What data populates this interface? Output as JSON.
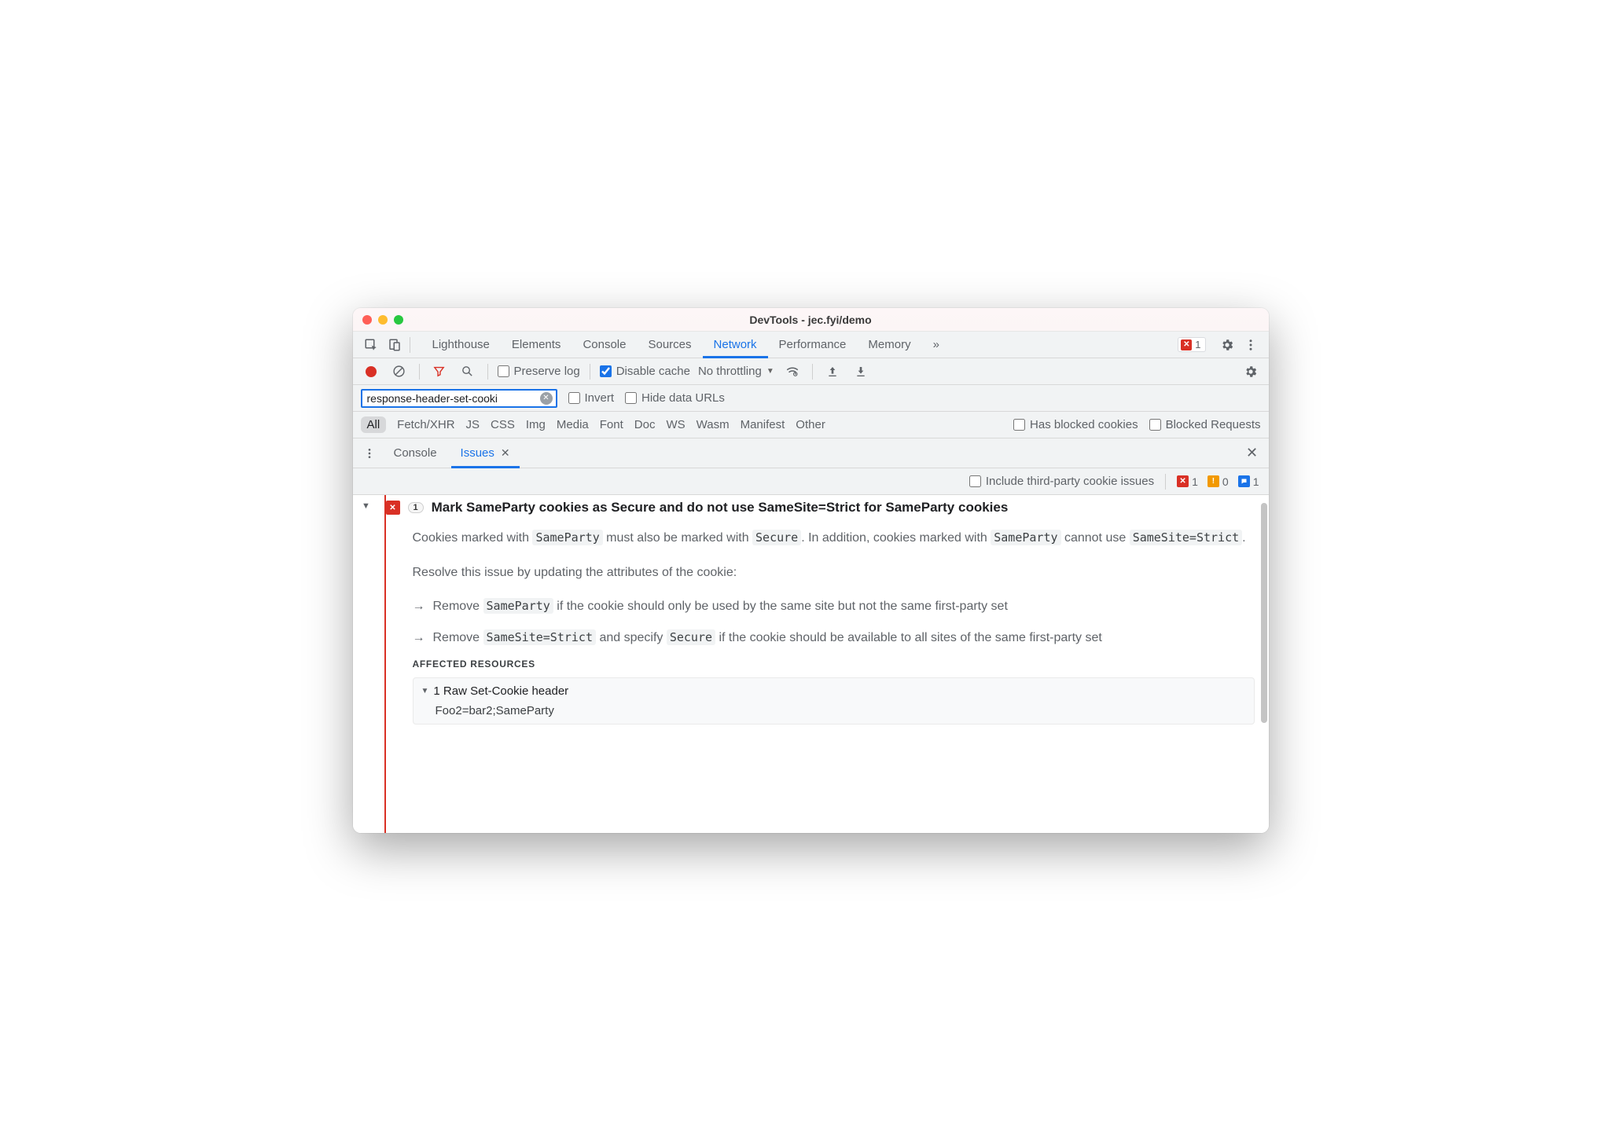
{
  "window": {
    "title": "DevTools - jec.fyi/demo"
  },
  "tabs": {
    "items": [
      "Lighthouse",
      "Elements",
      "Console",
      "Sources",
      "Network",
      "Performance",
      "Memory"
    ],
    "active": "Network",
    "overflow": "»"
  },
  "error_badge": {
    "count": "1"
  },
  "toolbar": {
    "preserve_log": "Preserve log",
    "disable_cache": "Disable cache",
    "throttling": "No throttling"
  },
  "filter": {
    "value": "response-header-set-cooki",
    "invert": "Invert",
    "hide_data_urls": "Hide data URLs"
  },
  "types": {
    "items": [
      "All",
      "Fetch/XHR",
      "JS",
      "CSS",
      "Img",
      "Media",
      "Font",
      "Doc",
      "WS",
      "Wasm",
      "Manifest",
      "Other"
    ],
    "selected": "All",
    "has_blocked_cookies": "Has blocked cookies",
    "blocked_requests": "Blocked Requests"
  },
  "drawer": {
    "tabs": [
      "Console",
      "Issues"
    ],
    "active": "Issues"
  },
  "issues_bar": {
    "include_third_party": "Include third-party cookie issues",
    "counts": {
      "error": "1",
      "warning": "0",
      "info": "1"
    }
  },
  "issue": {
    "count": "1",
    "title": "Mark SameParty cookies as Secure and do not use SameSite=Strict for SameParty cookies",
    "p1_a": "Cookies marked with ",
    "p1_code1": "SameParty",
    "p1_b": " must also be marked with ",
    "p1_code2": "Secure",
    "p1_c": ". In addition, cookies marked with ",
    "p1_code3": "SameParty",
    "p1_d": " cannot use ",
    "p1_code4": "SameSite=Strict",
    "p1_e": ".",
    "p2": "Resolve this issue by updating the attributes of the cookie:",
    "b1_a": "Remove ",
    "b1_code": "SameParty",
    "b1_b": " if the cookie should only be used by the same site but not the same first-party set",
    "b2_a": "Remove ",
    "b2_code1": "SameSite=Strict",
    "b2_b": " and specify ",
    "b2_code2": "Secure",
    "b2_c": " if the cookie should be available to all sites of the same first-party set",
    "affected_heading": "AFFECTED RESOURCES",
    "affected_summary": "1 Raw Set-Cookie header",
    "affected_value": "Foo2=bar2;SameParty"
  }
}
